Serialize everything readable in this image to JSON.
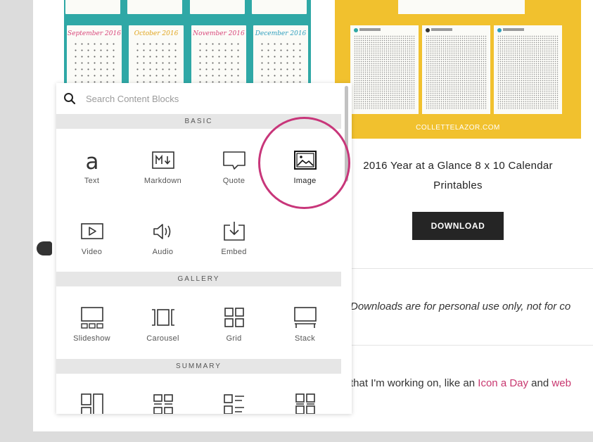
{
  "colors": {
    "highlight": "#c8367a",
    "link": "#c8376f",
    "teal_image": "#2fa8a6",
    "yellow_image": "#f1c12e",
    "button": "#252525"
  },
  "background_images": {
    "teal_calendar": {
      "months": [
        {
          "label": "September 2016",
          "color": "#d9467a"
        },
        {
          "label": "October 2016",
          "color": "#e1a41c"
        },
        {
          "label": "November 2016",
          "color": "#d9467a"
        },
        {
          "label": "December 2016",
          "color": "#2e9fbe"
        }
      ]
    },
    "yellow_calendar": {
      "caption": "COLLETTELAZOR.COM"
    }
  },
  "article": {
    "title": "2016 Year at a Glance 8 x 10 Calendar Printables",
    "download_label": "DOWNLOAD",
    "notice_text": "Downloads are for personal use only, not for co",
    "para_prefix": "that I'm working on, like an ",
    "para_link1": "Icon a Day",
    "para_mid": " and ",
    "para_link2": "web"
  },
  "panel": {
    "search": {
      "placeholder": "Search Content Blocks",
      "icon": "search-icon"
    },
    "sections": {
      "basic": {
        "title": "BASIC",
        "items": [
          {
            "label": "Text",
            "icon": "text-icon"
          },
          {
            "label": "Markdown",
            "icon": "markdown-icon"
          },
          {
            "label": "Quote",
            "icon": "quote-icon"
          },
          {
            "label": "Image",
            "icon": "image-icon"
          },
          {
            "label": "Video",
            "icon": "video-icon"
          },
          {
            "label": "Audio",
            "icon": "audio-icon"
          },
          {
            "label": "Embed",
            "icon": "embed-icon"
          }
        ]
      },
      "gallery": {
        "title": "GALLERY",
        "items": [
          {
            "label": "Slideshow",
            "icon": "slideshow-icon"
          },
          {
            "label": "Carousel",
            "icon": "carousel-icon"
          },
          {
            "label": "Grid",
            "icon": "grid-icon"
          },
          {
            "label": "Stack",
            "icon": "stack-icon"
          }
        ]
      },
      "summary": {
        "title": "SUMMARY",
        "items": [
          {
            "icon": "summary-wall-icon"
          },
          {
            "icon": "summary-grid-icon"
          },
          {
            "icon": "summary-list-icon"
          },
          {
            "icon": "summary-carousel-icon"
          }
        ]
      }
    }
  }
}
